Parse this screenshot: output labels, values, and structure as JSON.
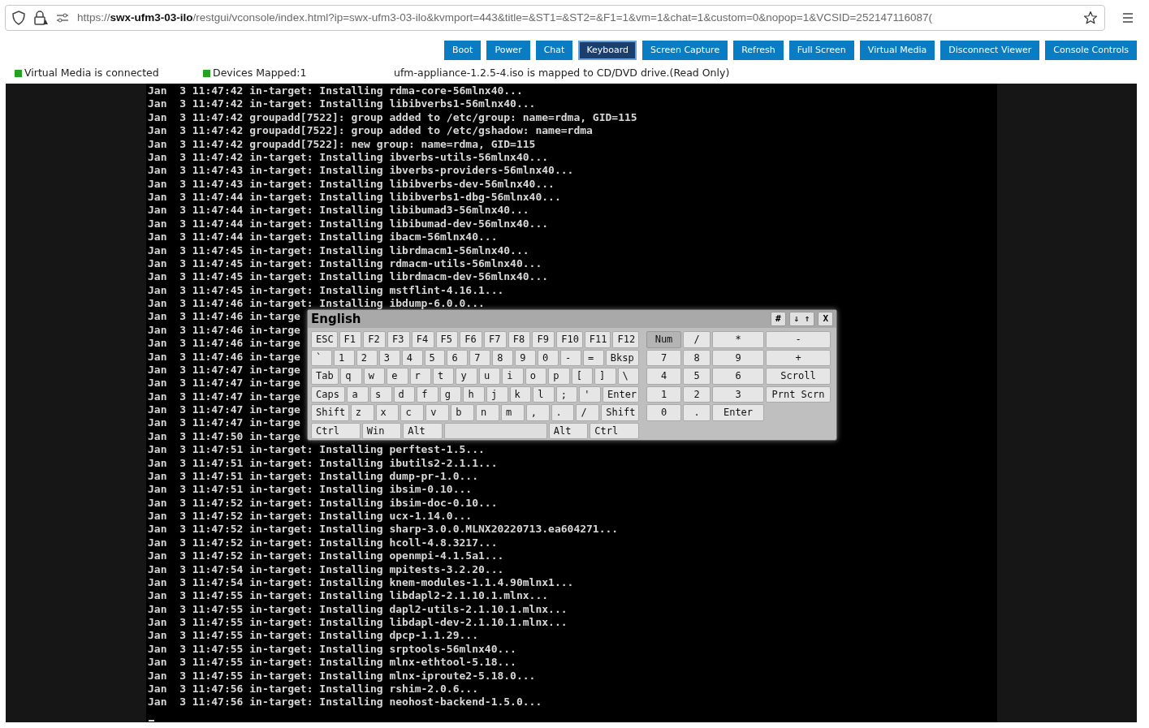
{
  "browser": {
    "url": "https://**swx-ufm3-03-ilo**/restgui/vconsole/index.html?ip=swx-ufm3-03-ilo&kvmport=443&title=&ST1=&ST2=&F1=1&vm=1&chat=1&custom=0&nopop=1&VCSID=252147116087("
  },
  "toolbar": [
    {
      "label": "Boot",
      "selected": false
    },
    {
      "label": "Power",
      "selected": false
    },
    {
      "label": "Chat",
      "selected": false
    },
    {
      "label": "Keyboard",
      "selected": true
    },
    {
      "label": "Screen Capture",
      "selected": false
    },
    {
      "label": "Refresh",
      "selected": false
    },
    {
      "label": "Full Screen",
      "selected": false
    },
    {
      "label": "Virtual Media",
      "selected": false
    },
    {
      "label": "Disconnect Viewer",
      "selected": false
    },
    {
      "label": "Console Controls",
      "selected": false
    }
  ],
  "status": {
    "items": [
      "Virtual Media is connected",
      "Devices Mapped:1"
    ],
    "message": "ufm-appliance-1.2.5-4.iso is mapped to CD/DVD drive.(Read Only)"
  },
  "console_lines": [
    "Jan  3 11:47:42 in-target: Installing rdma-core-56mlnx40...",
    "Jan  3 11:47:42 in-target: Installing libibverbs1-56mlnx40...",
    "Jan  3 11:47:42 groupadd[7522]: group added to /etc/group: name=rdma, GID=115",
    "Jan  3 11:47:42 groupadd[7522]: group added to /etc/gshadow: name=rdma",
    "Jan  3 11:47:42 groupadd[7522]: new group: name=rdma, GID=115",
    "Jan  3 11:47:42 in-target: Installing ibverbs-utils-56mlnx40...",
    "Jan  3 11:47:43 in-target: Installing ibverbs-providers-56mlnx40...",
    "Jan  3 11:47:43 in-target: Installing libibverbs-dev-56mlnx40...",
    "Jan  3 11:47:44 in-target: Installing libibverbs1-dbg-56mlnx40...",
    "Jan  3 11:47:44 in-target: Installing libibumad3-56mlnx40...",
    "Jan  3 11:47:44 in-target: Installing libibumad-dev-56mlnx40...",
    "Jan  3 11:47:44 in-target: Installing ibacm-56mlnx40...",
    "Jan  3 11:47:45 in-target: Installing librdmacm1-56mlnx40...",
    "Jan  3 11:47:45 in-target: Installing rdmacm-utils-56mlnx40...",
    "Jan  3 11:47:45 in-target: Installing librdmacm-dev-56mlnx40...",
    "Jan  3 11:47:45 in-target: Installing mstflint-4.16.1...",
    "Jan  3 11:47:46 in-target: Installing ibdump-6.0.0...",
    "Jan  3 11:47:46 in-targe",
    "Jan  3 11:47:46 in-targe",
    "Jan  3 11:47:46 in-targe",
    "Jan  3 11:47:46 in-targe",
    "Jan  3 11:47:47 in-targe",
    "Jan  3 11:47:47 in-targe",
    "Jan  3 11:47:47 in-targe",
    "Jan  3 11:47:47 in-targe",
    "Jan  3 11:47:47 in-targe",
    "Jan  3 11:47:50 in-targe",
    "Jan  3 11:47:51 in-target: Installing perftest-1.5...",
    "Jan  3 11:47:51 in-target: Installing ibutils2-2.1.1...",
    "Jan  3 11:47:51 in-target: Installing dump-pr-1.0...",
    "Jan  3 11:47:51 in-target: Installing ibsim-0.10...",
    "Jan  3 11:47:52 in-target: Installing ibsim-doc-0.10...",
    "Jan  3 11:47:52 in-target: Installing ucx-1.14.0...",
    "Jan  3 11:47:52 in-target: Installing sharp-3.0.0.MLNX20220713.ea604271...",
    "Jan  3 11:47:52 in-target: Installing hcoll-4.8.3217...",
    "Jan  3 11:47:52 in-target: Installing openmpi-4.1.5a1...",
    "Jan  3 11:47:54 in-target: Installing mpitests-3.2.20...",
    "Jan  3 11:47:54 in-target: Installing knem-modules-1.1.4.90mlnx1...",
    "Jan  3 11:47:55 in-target: Installing libdapl2-2.1.10.1.mlnx...",
    "Jan  3 11:47:55 in-target: Installing dapl2-utils-2.1.10.1.mlnx...",
    "Jan  3 11:47:55 in-target: Installing libdapl-dev-2.1.10.1.mlnx...",
    "Jan  3 11:47:55 in-target: Installing dpcp-1.1.29...",
    "Jan  3 11:47:55 in-target: Installing srptools-56mlnx40...",
    "Jan  3 11:47:55 in-target: Installing mlnx-ethtool-5.18...",
    "Jan  3 11:47:55 in-target: Installing mlnx-iproute2-5.18.0...",
    "Jan  3 11:47:56 in-target: Installing rshim-2.0.6...",
    "Jan  3 11:47:56 in-target: Installing neohost-backend-1.5.0..."
  ],
  "keyboard": {
    "title": "English",
    "header_buttons": [
      "#",
      "⇓ ⇑",
      "X"
    ],
    "rows": [
      {
        "keys": [
          {
            "label": "ESC"
          },
          {
            "label": "F1"
          },
          {
            "label": "F2"
          },
          {
            "label": "F3"
          },
          {
            "label": "F4"
          },
          {
            "label": "F5"
          },
          {
            "label": "F6"
          },
          {
            "label": "F7"
          },
          {
            "label": "F8"
          },
          {
            "label": "F9"
          },
          {
            "label": "F10"
          },
          {
            "label": "F11"
          },
          {
            "label": "F12"
          }
        ]
      },
      {
        "keys": [
          {
            "label": "`"
          },
          {
            "label": "1"
          },
          {
            "label": "2"
          },
          {
            "label": "3"
          },
          {
            "label": "4"
          },
          {
            "label": "5"
          },
          {
            "label": "6"
          },
          {
            "label": "7"
          },
          {
            "label": "8"
          },
          {
            "label": "9"
          },
          {
            "label": "0"
          },
          {
            "label": "-"
          },
          {
            "label": "="
          },
          {
            "label": "Bksp"
          }
        ]
      },
      {
        "keys": [
          {
            "label": "Tab"
          },
          {
            "label": "q"
          },
          {
            "label": "w"
          },
          {
            "label": "e"
          },
          {
            "label": "r"
          },
          {
            "label": "t"
          },
          {
            "label": "y"
          },
          {
            "label": "u"
          },
          {
            "label": "i"
          },
          {
            "label": "o"
          },
          {
            "label": "p"
          },
          {
            "label": "["
          },
          {
            "label": "]"
          },
          {
            "label": "\\"
          }
        ]
      },
      {
        "keys": [
          {
            "label": "Caps"
          },
          {
            "label": "a"
          },
          {
            "label": "s"
          },
          {
            "label": "d"
          },
          {
            "label": "f"
          },
          {
            "label": "g"
          },
          {
            "label": "h"
          },
          {
            "label": "j"
          },
          {
            "label": "k"
          },
          {
            "label": "l"
          },
          {
            "label": ";"
          },
          {
            "label": "'"
          },
          {
            "label": "Enter"
          }
        ]
      },
      {
        "keys": [
          {
            "label": "Shift"
          },
          {
            "label": "z"
          },
          {
            "label": "x"
          },
          {
            "label": "c"
          },
          {
            "label": "v"
          },
          {
            "label": "b"
          },
          {
            "label": "n"
          },
          {
            "label": "m"
          },
          {
            "label": ","
          },
          {
            "label": "."
          },
          {
            "label": "/"
          },
          {
            "label": "Shift"
          }
        ]
      },
      {
        "keys": [
          {
            "label": "Ctrl"
          },
          {
            "label": "Win"
          },
          {
            "label": "Alt"
          },
          {
            "kind": "space"
          },
          {
            "label": "Alt"
          },
          {
            "label": "Ctrl"
          }
        ]
      }
    ],
    "numpad": [
      {
        "label": "Num",
        "on": true
      },
      {
        "label": "/",
        "on": false
      },
      {
        "label": "*",
        "on": false
      },
      {
        "label": "-",
        "on": false
      },
      {
        "label": "7",
        "on": false
      },
      {
        "label": "8",
        "on": false
      },
      {
        "label": "9",
        "on": false
      },
      {
        "label": "+",
        "on": false
      },
      {
        "label": "4",
        "on": false
      },
      {
        "label": "5",
        "on": false
      },
      {
        "label": "6",
        "on": false
      },
      {
        "label": "Scroll",
        "on": false
      },
      {
        "label": "1",
        "on": false
      },
      {
        "label": "2",
        "on": false
      },
      {
        "label": "3",
        "on": false
      },
      {
        "label": "Prnt Scrn",
        "on": false
      },
      {
        "label": "0",
        "on": false
      },
      {
        "label": ".",
        "on": false
      },
      {
        "label": "Enter",
        "on": false
      }
    ]
  }
}
